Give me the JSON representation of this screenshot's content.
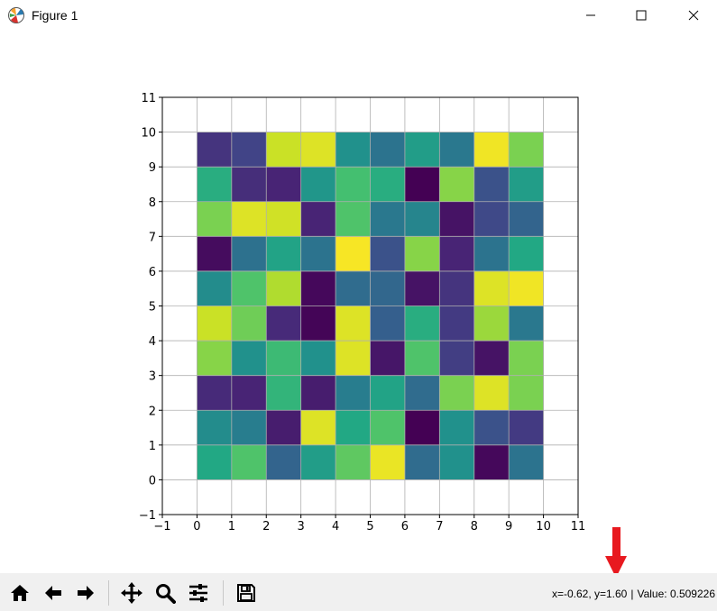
{
  "window": {
    "title": "Figure 1",
    "app_icon": "matplotlib-icon",
    "controls": [
      "minimize-icon",
      "maximize-icon",
      "close-icon"
    ]
  },
  "chart_data": {
    "type": "heatmap",
    "colormap": "viridis",
    "x_ticks": [
      "−1",
      "0",
      "1",
      "2",
      "3",
      "4",
      "5",
      "6",
      "7",
      "8",
      "9",
      "10",
      "11"
    ],
    "y_ticks": [
      "−1",
      "0",
      "1",
      "2",
      "3",
      "4",
      "5",
      "6",
      "7",
      "8",
      "9",
      "10",
      "11"
    ],
    "xlim": [
      -1,
      11
    ],
    "ylim": [
      -1,
      11
    ],
    "grid": true,
    "rows_top_to_bottom": [
      [
        0.15,
        0.2,
        0.92,
        0.95,
        0.5,
        0.38,
        0.55,
        0.4,
        0.98,
        0.8
      ],
      [
        0.62,
        0.13,
        0.1,
        0.52,
        0.7,
        0.62,
        0.0,
        0.82,
        0.25,
        0.55
      ],
      [
        0.8,
        0.95,
        0.93,
        0.1,
        0.72,
        0.4,
        0.45,
        0.05,
        0.22,
        0.32
      ],
      [
        0.03,
        0.37,
        0.58,
        0.38,
        0.99,
        0.25,
        0.82,
        0.1,
        0.38,
        0.6
      ],
      [
        0.48,
        0.72,
        0.88,
        0.02,
        0.35,
        0.33,
        0.05,
        0.15,
        0.95,
        0.98
      ],
      [
        0.92,
        0.78,
        0.12,
        0.01,
        0.95,
        0.3,
        0.62,
        0.17,
        0.85,
        0.4
      ],
      [
        0.82,
        0.5,
        0.68,
        0.5,
        0.95,
        0.06,
        0.72,
        0.18,
        0.05,
        0.8
      ],
      [
        0.12,
        0.1,
        0.65,
        0.08,
        0.42,
        0.58,
        0.35,
        0.8,
        0.95,
        0.8
      ],
      [
        0.48,
        0.42,
        0.08,
        0.95,
        0.6,
        0.72,
        0.0,
        0.5,
        0.25,
        0.17
      ],
      [
        0.6,
        0.72,
        0.32,
        0.55,
        0.75,
        0.97,
        0.35,
        0.5,
        0.02,
        0.38
      ]
    ]
  },
  "toolbar": {
    "buttons": [
      "home-icon",
      "back-icon",
      "forward-icon",
      "pan-icon",
      "zoom-icon",
      "configure-subplots-icon",
      "save-icon"
    ]
  },
  "status": {
    "coords": "x=-0.62, y=1.60",
    "separator": "|",
    "value": "Value: 0.509226"
  },
  "annotation": {
    "arrow_color": "#e8191f"
  }
}
